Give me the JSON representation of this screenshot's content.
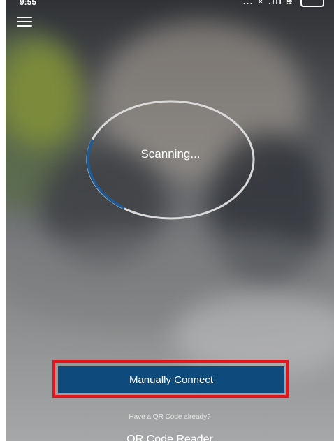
{
  "status_bar": {
    "time": "9:55",
    "icons": "... ✕ .ıll ≋",
    "battery_icon": "battery-icon"
  },
  "header": {
    "menu_icon": "hamburger-menu-icon"
  },
  "scanner": {
    "status_text": "Scanning...",
    "ring_color": "#d9d9d9",
    "progress_color": "#1f5a94"
  },
  "actions": {
    "manually_connect_label": "Manually Connect",
    "qr_prompt": "Have a QR Code already?",
    "qr_reader_label": "QR Code Reader",
    "button_color": "#0f4a7c",
    "highlight_color": "#e8141b"
  }
}
